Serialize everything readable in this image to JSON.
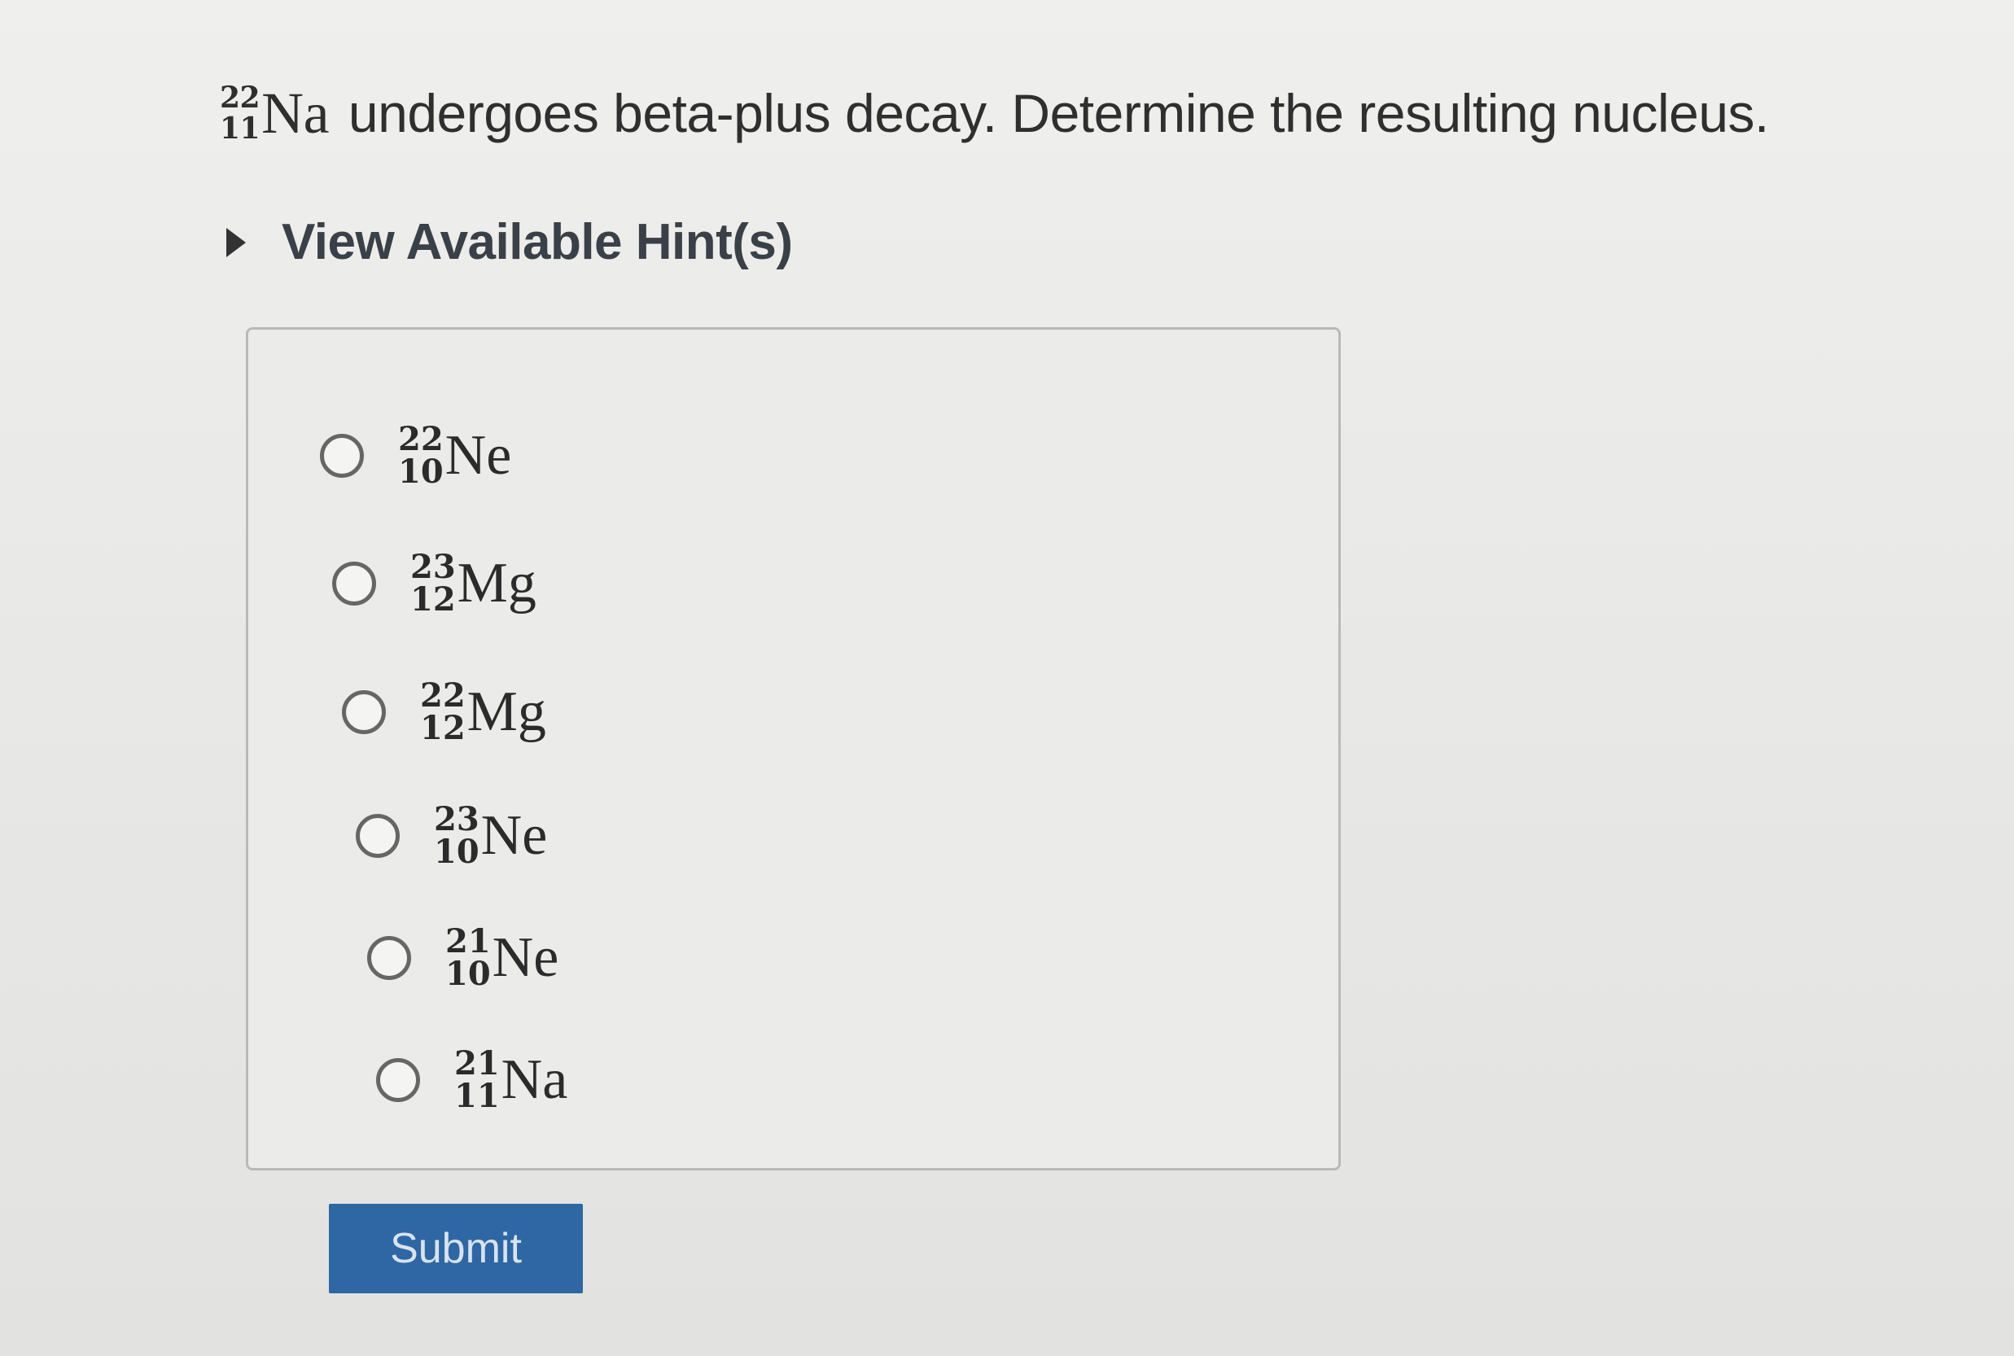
{
  "question": {
    "nuclide": {
      "mass": "22",
      "atomic": "11",
      "symbol": "Na"
    },
    "text": "undergoes beta-plus decay. Determine the resulting nucleus."
  },
  "hint": {
    "label": "View Available Hint(s)",
    "icon": "caret-right-icon"
  },
  "options": [
    {
      "mass": "22",
      "atomic": "10",
      "symbol": "Ne"
    },
    {
      "mass": "23",
      "atomic": "12",
      "symbol": "Mg"
    },
    {
      "mass": "22",
      "atomic": "12",
      "symbol": "Mg"
    },
    {
      "mass": "23",
      "atomic": "10",
      "symbol": "Ne"
    },
    {
      "mass": "21",
      "atomic": "10",
      "symbol": "Ne"
    },
    {
      "mass": "21",
      "atomic": "11",
      "symbol": "Na"
    }
  ],
  "submit": {
    "label": "Submit"
  },
  "colors": {
    "accent": "#2e67a3",
    "background": "#e9e9e7"
  }
}
